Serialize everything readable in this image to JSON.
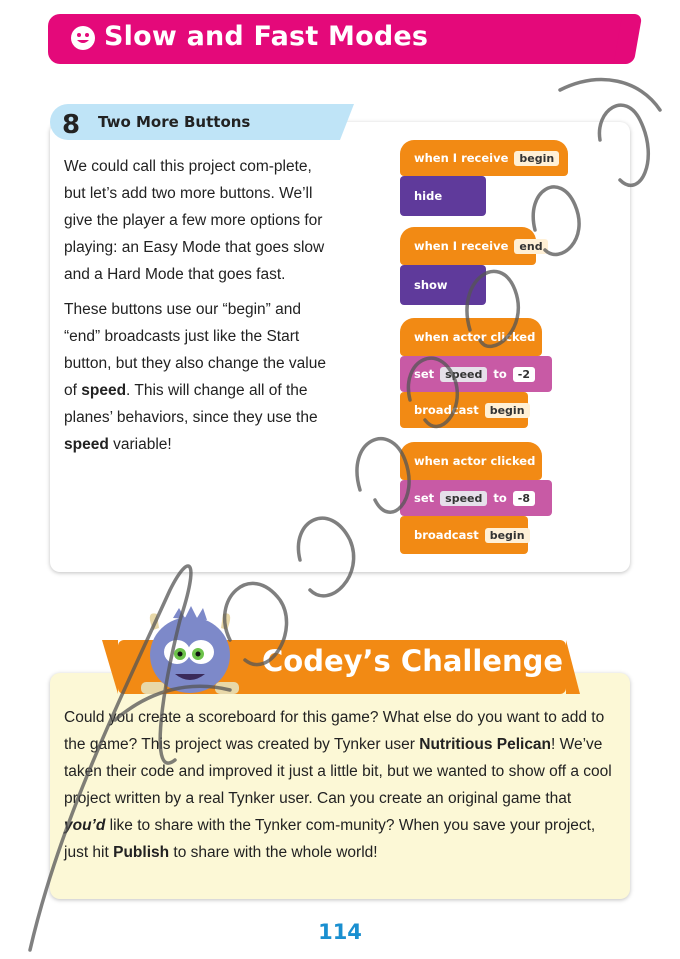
{
  "title": "Slow and Fast Modes",
  "step": {
    "number": "8",
    "title": "Two More Buttons",
    "para1_before": "We could call this project com-plete, but let’s add two more buttons. We’ll give the player a few more options for playing: an Easy Mode that goes slow and a Hard Mode that goes fast.",
    "para2_a": "These buttons use our “begin” and “end” broadcasts just like the Start button, but they also change the value of ",
    "para2_b": "speed",
    "para2_c": ". This will change all of the planes’ behaviors, since they use the ",
    "para2_d": "speed",
    "para2_e": " variable!"
  },
  "code": {
    "when_receive": "when I receive",
    "begin": "begin",
    "end": "end",
    "hide": "hide",
    "show": "show",
    "when_actor_clicked": "when actor clicked",
    "set": "set",
    "speed": "speed",
    "to": "to",
    "val1": "-2",
    "val2": "-8",
    "broadcast": "broadcast"
  },
  "challenge": {
    "title": "Codey’s Challenge",
    "t1": "Could you create a scoreboard for this game? What else do you want to add to the game? This project was created by Tynker user ",
    "t2": "Nutritious Pelican",
    "t3": "! We’ve taken their code and improved it just a little bit, but we wanted to show off a cool project written by a real Tynker user. Can you create an original game that ",
    "t4": "you’d",
    "t5": " like to share with the Tynker com-munity? When you save your project, just hit ",
    "t6": "Publish",
    "t7": " to share with the whole world!"
  },
  "page_number": "114",
  "colors": {
    "title_banner": "#e4097a",
    "step_tab": "#bfe4f7",
    "block_orange": "#f28a14",
    "block_purple": "#5f3a9b",
    "block_pink": "#c85aa5",
    "challenge_bg": "#fcf8d6",
    "page_number": "#1a8fd0"
  }
}
